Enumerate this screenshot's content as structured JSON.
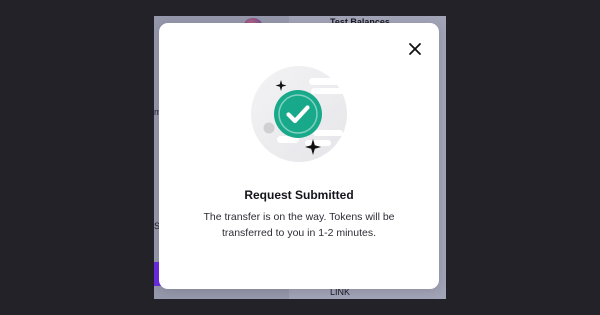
{
  "background_app": {
    "heading_fragment": "Test Balances",
    "left_fragment_1": "m",
    "left_fragment_2": "Si",
    "footer_link": "LINK"
  },
  "modal": {
    "title": "Request Submitted",
    "description": "The transfer is on the way. Tokens will be transferred to you in 1-2 minutes.",
    "close_icon": "close-icon",
    "illustration_icon": "check-circle-icon"
  },
  "colors": {
    "accent": "#17a98a",
    "overlay": "#222228",
    "modal_bg": "#ffffff"
  }
}
